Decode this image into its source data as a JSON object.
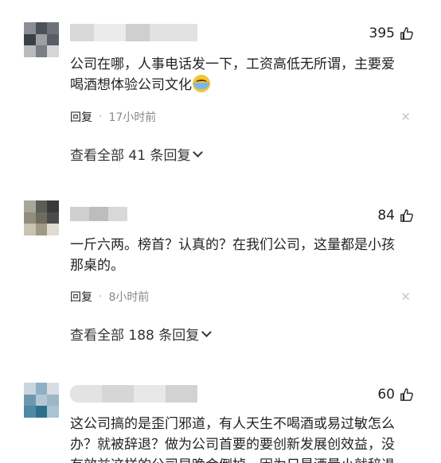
{
  "comments": [
    {
      "likes": "395",
      "text_line1": "公司在哪，人事电话发一下，工资高低无所谓，主要爱",
      "text_line2": "喝酒想体验公司文化",
      "emoji": "crying-laughing-emoji",
      "reply_label": "回复",
      "time": "17小时前",
      "view_replies": "查看全部 41 条回复"
    },
    {
      "likes": "84",
      "text_line1": "一斤六两。榜首？认真的？在我们公司，这量都是小孩",
      "text_line2": "那桌的。",
      "reply_label": "回复",
      "time": "8小时前",
      "view_replies": "查看全部 188 条回复"
    },
    {
      "likes": "60",
      "text_line1": "这公司搞的是歪门邪道，有人天生不喝酒或易过敏怎么",
      "text_line2": "办？就被辞退？做为公司首要的要创新发展创效益，没",
      "text_line3": "有效益这样的公司早晚会倒掉，因为只是酒量小就辞退"
    }
  ],
  "icons": {
    "like": "thumbs-up-icon",
    "close": "close-icon",
    "expand": "chevron-down-icon"
  },
  "colors": {
    "text": "#222222",
    "muted": "#888888",
    "close": "#c8c8c8"
  }
}
